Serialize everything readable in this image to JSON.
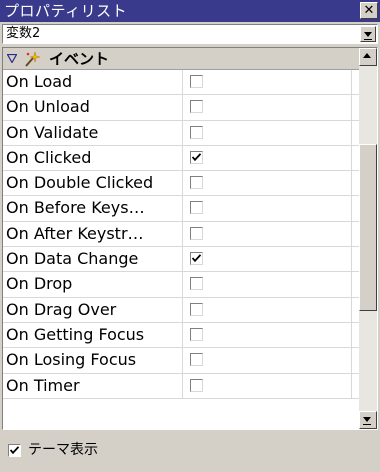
{
  "window": {
    "title": "プロパティリスト"
  },
  "selector": {
    "value": "変数2"
  },
  "category": {
    "label": "イベント",
    "icon": "wand-icon"
  },
  "rows": [
    {
      "name": "On Load",
      "checked": false
    },
    {
      "name": "On Unload",
      "checked": false
    },
    {
      "name": "On Validate",
      "checked": false
    },
    {
      "name": "On Clicked",
      "checked": true
    },
    {
      "name": "On Double Clicked",
      "checked": false
    },
    {
      "name": "On Before Keys…",
      "checked": false
    },
    {
      "name": "On After Keystr…",
      "checked": false
    },
    {
      "name": "On Data Change",
      "checked": true
    },
    {
      "name": "On Drop",
      "checked": false
    },
    {
      "name": "On Drag Over",
      "checked": false
    },
    {
      "name": "On Getting Focus",
      "checked": false
    },
    {
      "name": "On Losing Focus",
      "checked": false
    },
    {
      "name": "On Timer",
      "checked": false
    }
  ],
  "footer": {
    "theme_label": "テーマ表示",
    "theme_checked": true
  },
  "colors": {
    "titlebar": "#3a3a8c",
    "face": "#d4d0c8",
    "grid": "#d8d8d8"
  }
}
